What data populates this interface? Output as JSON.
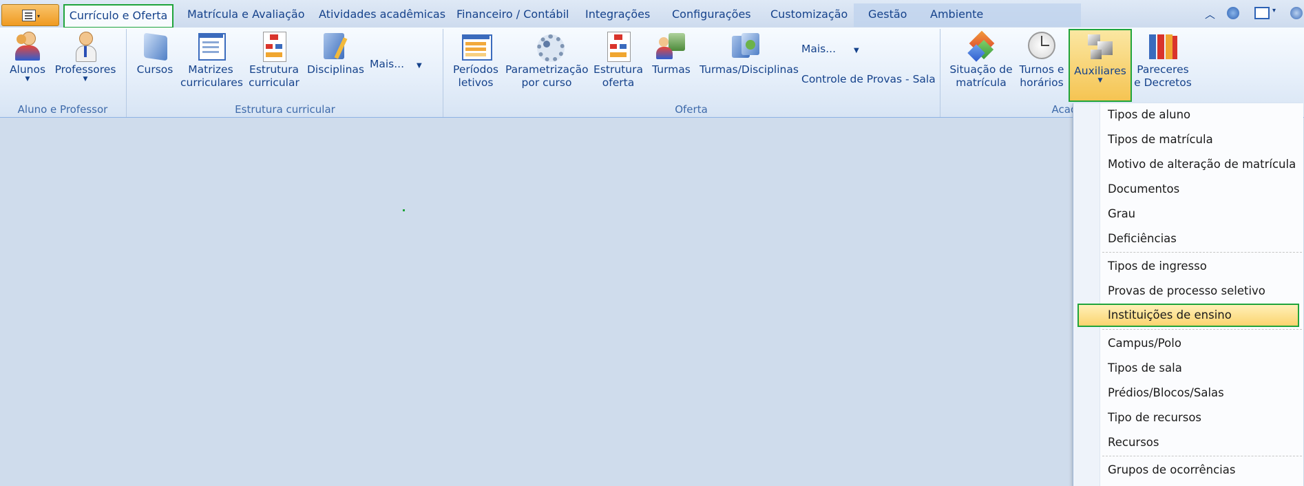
{
  "tabs": [
    "Currículo e Oferta",
    "Matrícula e Avaliação",
    "Atividades acadêmicas",
    "Financeiro / Contábil",
    "Integrações",
    "Configurações",
    "Customização",
    "Gestão",
    "Ambiente"
  ],
  "ribbon": {
    "aluno_professor": {
      "group": "Aluno e Professor",
      "alunos": "Alunos",
      "professores": "Professores"
    },
    "estrutura": {
      "group": "Estrutura curricular",
      "cursos": "Cursos",
      "matrizes_1": "Matrizes",
      "matrizes_2": "curriculares",
      "estrutura_1": "Estrutura",
      "estrutura_2": "curricular",
      "disciplinas": "Disciplinas",
      "mais": "Mais..."
    },
    "oferta": {
      "group": "Oferta",
      "periodos_1": "Períodos",
      "periodos_2": "letivos",
      "param_1": "Parametrização",
      "param_2": "por curso",
      "estrut_1": "Estrutura",
      "estrut_2": "oferta",
      "turmas": "Turmas",
      "turmas_disc": "Turmas/Disciplinas",
      "mais": "Mais...",
      "controle": "Controle de Provas - Sala"
    },
    "acad": {
      "group": "Acad",
      "situacao_1": "Situação de",
      "situacao_2": "matrícula",
      "turnos_1": "Turnos e",
      "turnos_2": "horários",
      "auxiliares": "Auxiliares",
      "pareceres_1": "Pareceres",
      "pareceres_2": "e Decretos"
    }
  },
  "menu": {
    "items": [
      "Tipos de aluno",
      "Tipos de matrícula",
      "Motivo de alteração de matrícula",
      "Documentos",
      "Grau",
      "Deficiências",
      "Tipos de ingresso",
      "Provas de processo seletivo",
      "Instituições de ensino",
      "Campus/Polo",
      "Tipos de sala",
      "Prédios/Blocos/Salas",
      "Tipo de recursos",
      "Recursos",
      "Grupos de ocorrências"
    ],
    "highlighted": "Instituições de ensino"
  },
  "colors": {
    "accent_green": "#1fa43b",
    "ribbon_text": "#15428b",
    "highlight": "#fbd46f"
  }
}
